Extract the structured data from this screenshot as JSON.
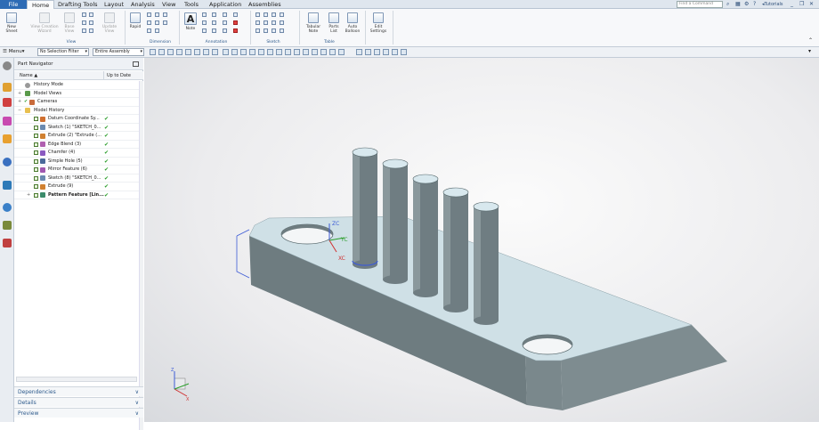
{
  "menubar": {
    "tabs": [
      {
        "label": "File"
      },
      {
        "label": "Home"
      },
      {
        "label": "Drafting Tools"
      },
      {
        "label": "Layout"
      },
      {
        "label": "Analysis"
      },
      {
        "label": "View"
      },
      {
        "label": "Tools"
      },
      {
        "label": "Application"
      },
      {
        "label": "Assemblies"
      }
    ],
    "find_placeholder": "Find a Command",
    "tutorials_label": "Tutorials"
  },
  "ribbon": {
    "new_sheet": "New Sheet",
    "view_creation_wizard": "View Creation Wizard",
    "base_view": "Base View",
    "update_view": "Update View",
    "rapid": "Rapid",
    "note": "Note",
    "tabular_note": "Tabular Note",
    "parts_list": "Parts List",
    "auto_balloon": "Auto Balloon",
    "edit_settings": "Edit Settings",
    "groups": {
      "view": "View",
      "dimension": "Dimension",
      "annotation": "Annotation",
      "sketch": "Sketch",
      "table": "Table"
    }
  },
  "toolbar2": {
    "menu_label": "Menu",
    "selection_filter": "No Selection Filter",
    "scope": "Entire Assembly"
  },
  "navigator": {
    "title": "Part Navigator",
    "col_name": "Name",
    "col_uptodate": "Up to Date",
    "rows": [
      {
        "label": "History Mode"
      },
      {
        "label": "Model Views"
      },
      {
        "label": "Cameras"
      },
      {
        "label": "Model History"
      },
      {
        "label": "Datum Coordinate Sy..."
      },
      {
        "label": "Sketch (1) \"SKETCH_0..."
      },
      {
        "label": "Extrude (2) \"Extrude (..."
      },
      {
        "label": "Edge Blend (3)"
      },
      {
        "label": "Chamfer (4)"
      },
      {
        "label": "Simple Hole (5)"
      },
      {
        "label": "Mirror Feature (6)"
      },
      {
        "label": "Sketch (8) \"SKETCH_0..."
      },
      {
        "label": "Extrude (9)"
      },
      {
        "label": "Pattern Feature [Lin..."
      }
    ],
    "panels": {
      "dependencies": "Dependencies",
      "details": "Details",
      "preview": "Preview"
    }
  },
  "viewport": {
    "axis_zc": "ZC",
    "axis_yc": "YC",
    "axis_xc": "XC",
    "triad_x": "X",
    "triad_z": "Z"
  },
  "colors": {
    "file_tab": "#2e6cb5",
    "model_face": "#cfe0e6",
    "model_side": "#6e7c80",
    "datum": "#3d5bd6"
  }
}
